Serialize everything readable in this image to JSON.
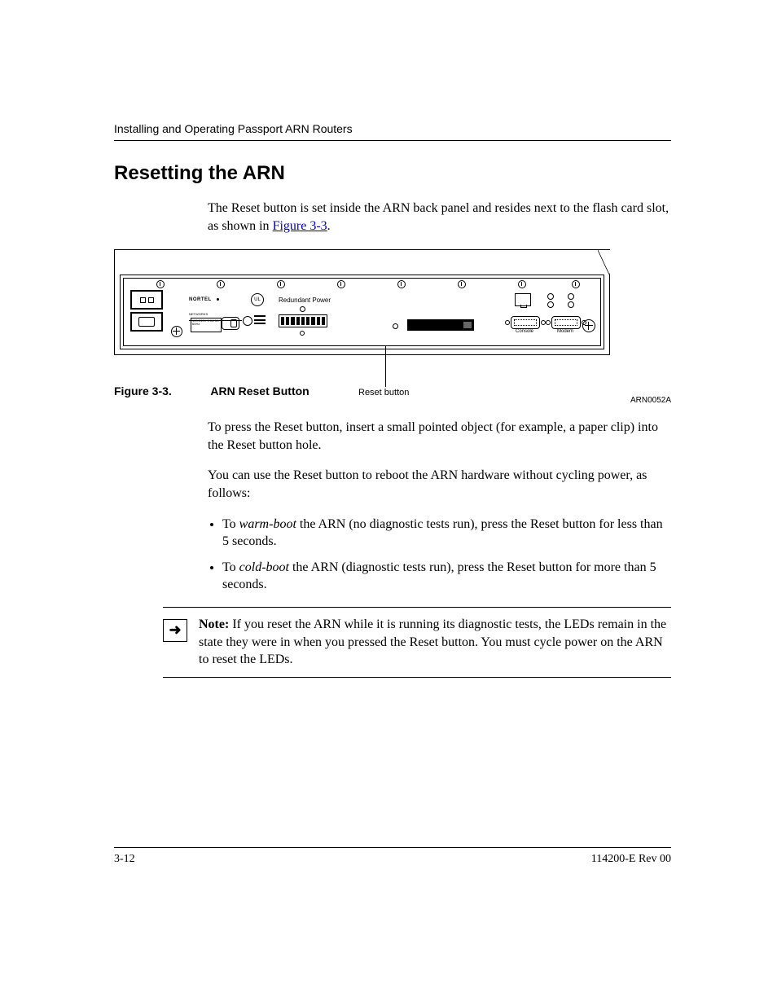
{
  "header": {
    "running_head": "Installing and Operating Passport ARN Routers"
  },
  "section": {
    "title": "Resetting the ARN",
    "intro_a": "The Reset button is set inside the ARN back panel and resides next to the flash card slot, as shown in ",
    "intro_link": "Figure 3-3",
    "intro_b": "."
  },
  "figure": {
    "callout": "Reset button",
    "id": "ARN0052A",
    "caption_label": "Figure 3-3.",
    "caption_title": "ARN Reset Button",
    "panel": {
      "brand": "NORTEL",
      "brand_sub": "NETWORKS",
      "rp_label": "Redundant Power",
      "cert_mark": "UL",
      "spec_lines": "100-240V\n1.0A\n50-60Hz",
      "port_console": "Console",
      "port_modem": "Modem"
    }
  },
  "body": {
    "p1": "To press the Reset button, insert a small pointed object (for example, a paper clip) into the Reset button hole.",
    "p2": "You can use the Reset button to reboot the ARN hardware without cycling power, as follows:",
    "bullet1_a": "To ",
    "bullet1_em": "warm-boot",
    "bullet1_b": " the ARN (no diagnostic tests run), press the Reset button for less than 5 seconds.",
    "bullet2_a": "To ",
    "bullet2_em": "cold-boot",
    "bullet2_b": " the ARN (diagnostic tests run), press the Reset button for more than 5 seconds."
  },
  "note": {
    "label": "Note:",
    "arrow": "➜",
    "text": " If you reset the ARN while it is running its diagnostic tests, the LEDs remain in the state they were in when you pressed the Reset button. You must cycle power on the ARN to reset the LEDs."
  },
  "footer": {
    "page": "3-12",
    "doc": "114200-E Rev 00"
  }
}
